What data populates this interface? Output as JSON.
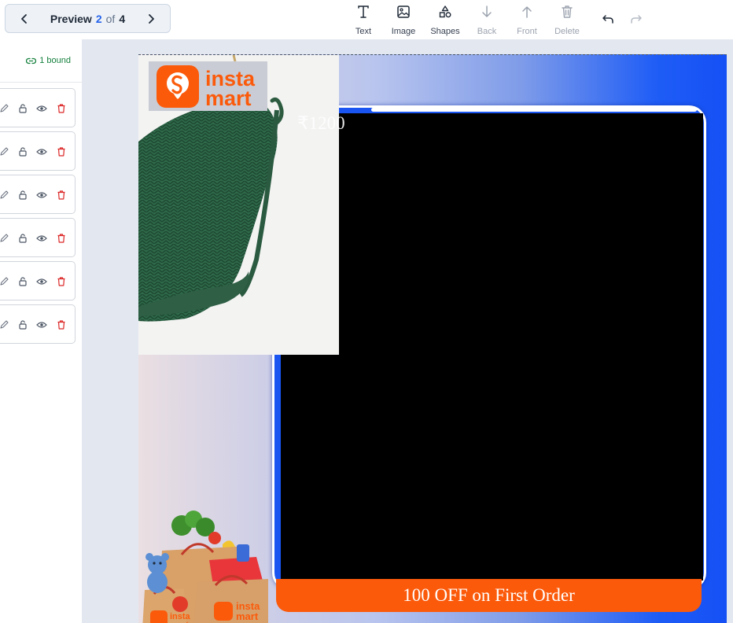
{
  "preview": {
    "label": "Preview",
    "current": "2",
    "of": "of",
    "total": "4"
  },
  "toolbar": {
    "text_label": "Text",
    "image_label": "Image",
    "shapes_label": "Shapes",
    "back_label": "Back",
    "front_label": "Front",
    "delete_label": "Delete"
  },
  "layers_panel": {
    "bound_label": "1 bound",
    "row_count_visible": 6
  },
  "canvas": {
    "logo_line1": "insta",
    "logo_line2": "mart",
    "price": "₹1200",
    "promo_text": "100 OFF on First Order",
    "bag_logo_line1": "insta",
    "bag_logo_line2": "mart"
  },
  "colors": {
    "accent": "#2563eb",
    "promo_orange": "#fb5a0b",
    "panel_blue": "#1a55f2",
    "delete_red": "#dc2626",
    "bound_green": "#15803d"
  },
  "icons": {
    "prev": "chevron-left-icon",
    "next": "chevron-right-icon",
    "text": "text-T-icon",
    "image": "image-icon",
    "shapes": "shapes-icon",
    "back": "arrow-down-icon",
    "front": "arrow-up-icon",
    "delete": "trash-icon",
    "undo": "undo-icon",
    "redo": "redo-icon",
    "bound": "link-icon",
    "layer_actions": [
      "pencil-icon",
      "lock-icon",
      "eye-icon",
      "trash-icon"
    ]
  }
}
